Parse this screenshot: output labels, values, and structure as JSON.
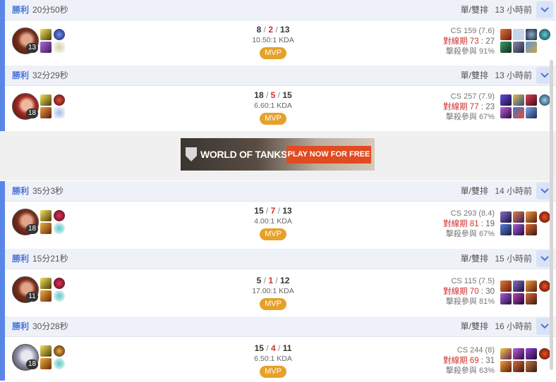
{
  "matches": [
    {
      "result": "勝利",
      "duration": "20分50秒",
      "queue": "單/雙排",
      "ago": "13 小時前",
      "level": "13",
      "kills": "8",
      "deaths": "2",
      "assists": "13",
      "kda": "10.50:1 KDA",
      "badge": "MVP",
      "cs": "CS 159 (7.6)",
      "lane_label": "對線期",
      "lane_win": "73",
      "lane_sep": ":",
      "lane_lose": "27",
      "kp": "擊殺參與 91%"
    },
    {
      "result": "勝利",
      "duration": "32分29秒",
      "queue": "單/雙排",
      "ago": "13 小時前",
      "level": "18",
      "kills": "18",
      "deaths": "5",
      "assists": "15",
      "kda": "6.60:1 KDA",
      "badge": "MVP",
      "cs": "CS 257 (7.9)",
      "lane_label": "對線期",
      "lane_win": "77",
      "lane_sep": ":",
      "lane_lose": "23",
      "kp": "擊殺參與 67%"
    },
    {
      "result": "勝利",
      "duration": "35分3秒",
      "queue": "單/雙排",
      "ago": "14 小時前",
      "level": "18",
      "kills": "15",
      "deaths": "7",
      "assists": "13",
      "kda": "4.00:1 KDA",
      "badge": "MVP",
      "cs": "CS 293 (8.4)",
      "lane_label": "對線期",
      "lane_win": "81",
      "lane_sep": ":",
      "lane_lose": "19",
      "kp": "擊殺參與 67%"
    },
    {
      "result": "勝利",
      "duration": "15分21秒",
      "queue": "單/雙排",
      "ago": "15 小時前",
      "level": "11",
      "kills": "5",
      "deaths": "1",
      "assists": "12",
      "kda": "17.00:1 KDA",
      "badge": "MVP",
      "cs": "CS 115 (7.5)",
      "lane_label": "對線期",
      "lane_win": "70",
      "lane_sep": ":",
      "lane_lose": "30",
      "kp": "擊殺參與 81%"
    },
    {
      "result": "勝利",
      "duration": "30分28秒",
      "queue": "單/雙排",
      "ago": "16 小時前",
      "level": "18",
      "kills": "15",
      "deaths": "4",
      "assists": "11",
      "kda": "6.50:1 KDA",
      "badge": "MVP",
      "cs": "CS 244 (8)",
      "lane_label": "對線期",
      "lane_win": "69",
      "lane_sep": ":",
      "lane_lose": "31",
      "kp": "擊殺參與 63%"
    }
  ],
  "ad": {
    "brand": "WORLD OF TANKS",
    "cta": "PLAY NOW FOR FREE"
  },
  "colors": {
    "accent": "#5a86e8",
    "death": "#d0312d",
    "mvp": "#e6a12a",
    "header_bg": "#eef1f8"
  }
}
